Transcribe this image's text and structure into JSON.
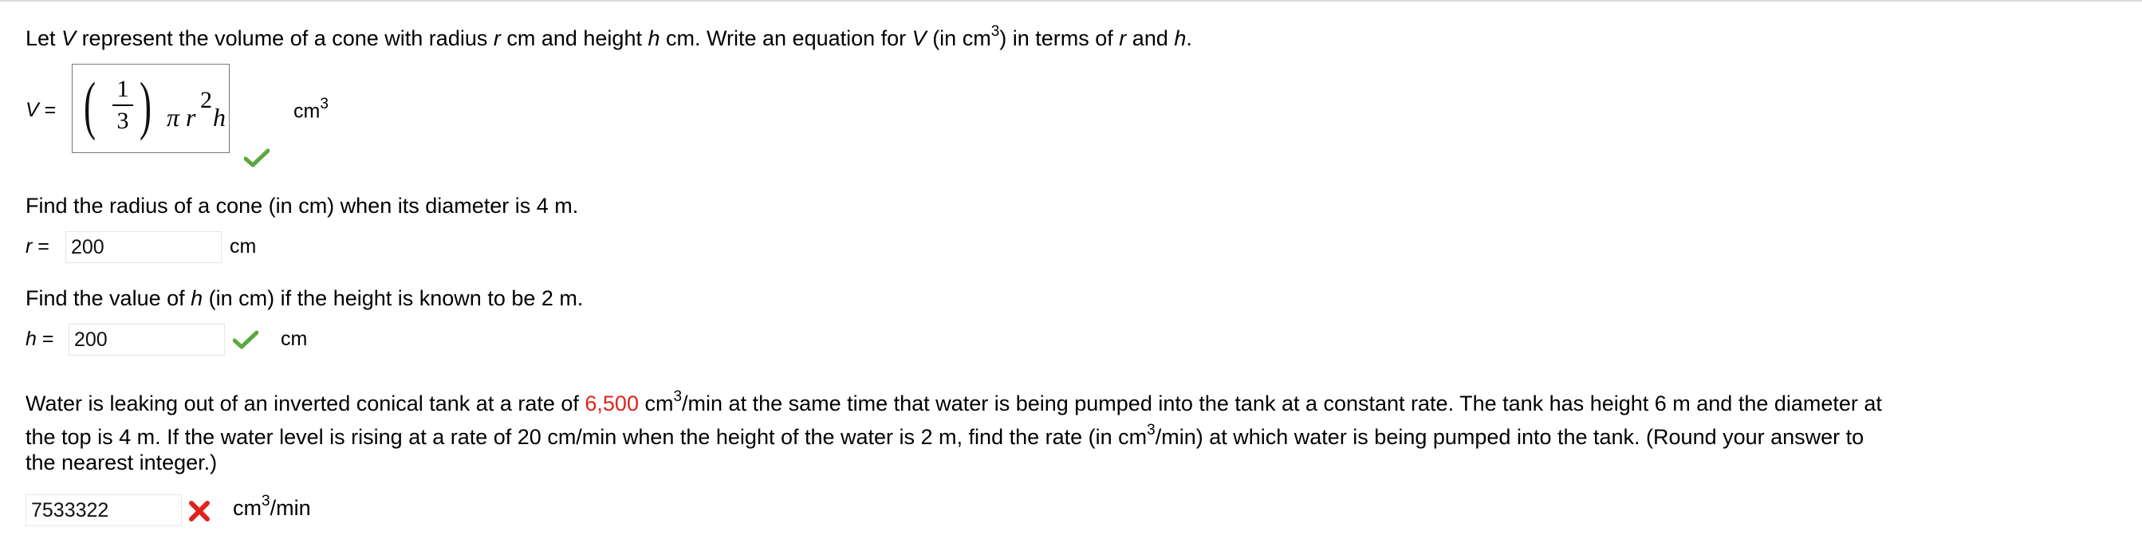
{
  "q1": {
    "p1": "Let ",
    "v1": "V",
    "p2": " represent the volume of a cone with radius ",
    "v2": "r",
    "p3": " cm and height ",
    "v3": "h",
    "p4": " cm. Write an equation for ",
    "v4": "V",
    "p5": " (in cm",
    "sup": "3",
    "p6": ") in terms of ",
    "v5": "r",
    "p7": " and ",
    "v6": "h",
    "p8": ".",
    "lhs_var": "V",
    "lhs_eq": " =",
    "num": "1",
    "den": "3",
    "pi": "π",
    "r": "r",
    "exp": "2",
    "h": "h",
    "unit": "cm",
    "unit_sup": "3",
    "status": "correct"
  },
  "q2": {
    "p1": "Find the radius of a cone (in cm) when its diameter is 4 m.",
    "label_var": "r",
    "label_eq": " =",
    "value": "200",
    "unit": "cm"
  },
  "q3": {
    "p1": "Find the value of ",
    "v1": "h",
    "p2": " (in cm) if the height is known to be 2 m.",
    "label_var": "h",
    "label_eq": " =",
    "value": "200",
    "unit": "cm",
    "status": "correct"
  },
  "q4": {
    "line1_a": "Water is leaking out of an inverted conical tank at a rate of ",
    "rate": "6,500",
    "line1_b": " cm",
    "line1_sup": "3",
    "line1_c": "/min at the same time that water is being pumped into the tank at a constant rate. The tank has height 6 m and the diameter at",
    "line2_a": "the top is 4 m. If the water level is rising at a rate of 20 cm/min when the height of the water is 2 m, find the rate (in cm",
    "line2_sup": "3",
    "line2_b": "/min) at which water is being pumped into the tank. (Round your answer to",
    "line3": "the nearest integer.)",
    "value": "7533322",
    "unit_a": "cm",
    "unit_sup": "3",
    "unit_b": "/min",
    "status": "incorrect"
  },
  "colors": {
    "highlight": "#e0221b",
    "check": "#5aa83f",
    "cross": "#e0221b"
  }
}
